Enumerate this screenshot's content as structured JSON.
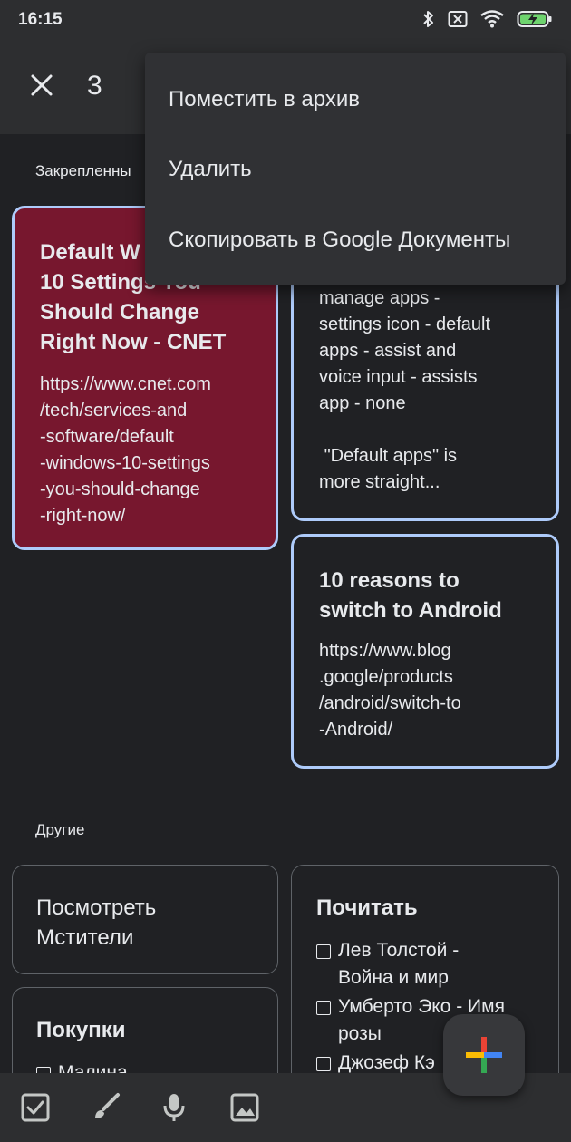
{
  "status_bar": {
    "time": "16:15"
  },
  "app_bar": {
    "selected_count": "3"
  },
  "menu": {
    "items": [
      {
        "label": "Поместить в архив"
      },
      {
        "label": "Удалить"
      },
      {
        "label": "Скопировать в Google Документы"
      }
    ]
  },
  "sections": {
    "pinned": "Закрепленны",
    "others": "Другие"
  },
  "pinned_notes": [
    {
      "title": "Default W\n10 Settings You\nShould Change\nRight Now - CNET",
      "body": "https://www.cnet.com\n/tech/services-and\n-software/default\n-windows-10-settings\n-you-should-change\n-right-now/",
      "color": "#77172e"
    },
    {
      "body": "manage apps -\nsettings icon - default\napps - assist and\nvoice input - assists\napp - none\n\n \"Default apps\" is\nmore straight..."
    },
    {
      "title": "10 reasons to\nswitch to Android",
      "body": "https://www.blog\n.google/products\n/android/switch-to\n-Android/"
    }
  ],
  "other_notes": [
    {
      "title": "Посмотреть\nМстители"
    },
    {
      "title": "Покупки",
      "items": [
        "Малина"
      ]
    },
    {
      "title": "Почитать",
      "items": [
        "Лев Толстой -\nВойна и мир",
        "Умберто Эко - Имя\nрозы",
        "Джозеф Кэ"
      ]
    }
  ],
  "colors": {
    "background": "#202124",
    "toolbar": "#2d2e30",
    "selected_border": "#aecbfa",
    "menu_bg": "#303134"
  },
  "icons": {
    "close": "close-icon",
    "bluetooth": "bluetooth-icon",
    "sim": "sim-icon",
    "wifi": "wifi-icon",
    "battery": "battery-charging-icon",
    "checkbox": "checkbox-icon",
    "brush": "brush-icon",
    "mic": "mic-icon",
    "image": "image-icon",
    "add": "add-icon"
  }
}
